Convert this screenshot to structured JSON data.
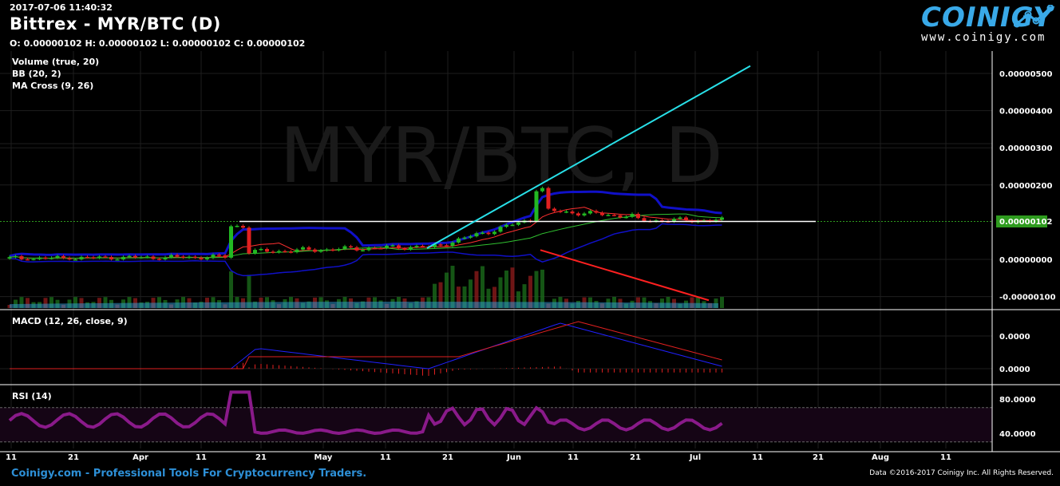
{
  "header": {
    "timestamp": "2017-07-06 11:40:32",
    "title": "Bittrex - MYR/BTC (D)",
    "ohlc": "O: 0.00000102 H: 0.00000102 L: 0.00000102 C: 0.00000102"
  },
  "logo": {
    "word": "COINIGY",
    "url": "www.coinigy.com"
  },
  "watermark": "MYR/BTC, D",
  "footer": {
    "tagline": "Coinigy.com - Professional Tools For Cryptocurrency Traders.",
    "copyright": "Data ©2016-2017 Coinigy Inc. All Rights Reserved."
  },
  "colors": {
    "background": "#000000",
    "up_candle": "#22b822",
    "down_candle": "#e02020",
    "bollinger": "#1010c8",
    "ma_fast": "#ff3030",
    "ma_slow": "#30c030",
    "volume_ma": "#2fa0d8",
    "trendline_up": "#28e0e8",
    "trendline_down": "#ff2020",
    "macd_line": "#2020ff",
    "macd_signal": "#e02020",
    "rsi": "#8a1a8a",
    "price_tag": "#2e9b1e"
  },
  "chart_data": {
    "type": "candlestick",
    "symbol": "MYR/BTC",
    "exchange": "Bittrex",
    "interval": "D",
    "last_price_label": "0.00000102",
    "x_ticks": [
      "11",
      "21",
      "Apr",
      "11",
      "21",
      "May",
      "11",
      "21",
      "Jun",
      "11",
      "21",
      "Jul",
      "11",
      "21",
      "Aug",
      "11"
    ],
    "price_panel": {
      "indicators": [
        "Volume (true, 20)",
        "BB (20, 2)",
        "MA Cross (9, 26)"
      ],
      "y_ticks": [
        "0.00000500",
        "0.00000400",
        "0.00000300",
        "0.00000200",
        "0.00000000",
        "-0.00000100"
      ],
      "y_range": [
        -1.2e-06,
        5.4e-06
      ]
    },
    "macd_panel": {
      "label": "MACD (12, 26, close, 9)",
      "y_ticks": [
        "0.0000",
        "0.0000"
      ]
    },
    "rsi_panel": {
      "label": "RSI (14)",
      "y_ticks": [
        "80.0000",
        "40.0000"
      ],
      "y_range": [
        30,
        95
      ],
      "levels": [
        70,
        30
      ]
    }
  }
}
